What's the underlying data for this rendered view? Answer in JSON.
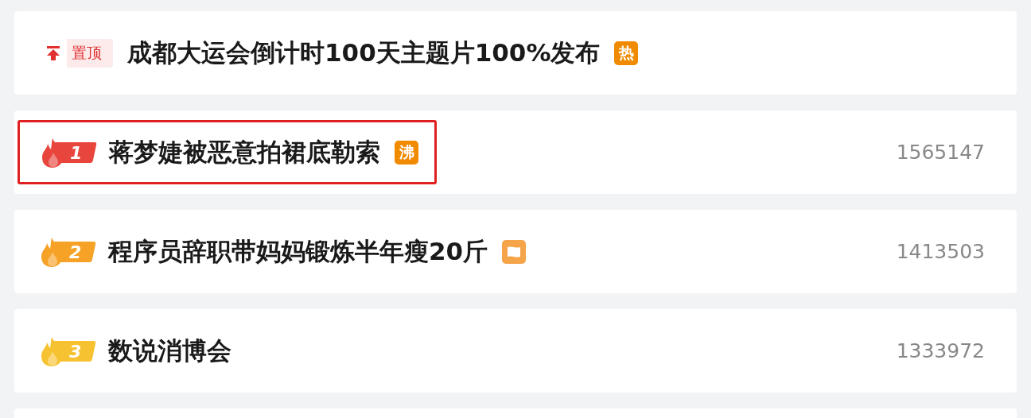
{
  "rows": [
    {
      "kind": "pinned",
      "label": "置顶",
      "title": "成都大运会倒计时100天主题片100%发布",
      "badge": {
        "kind": "text",
        "text": "热"
      },
      "highlighted": false
    },
    {
      "kind": "ranked",
      "rank": "1",
      "color": "#e8453c",
      "title": "蒋梦婕被恶意拍裙底勒索",
      "badge": {
        "kind": "text",
        "text": "沸"
      },
      "count": "1565147",
      "highlighted": true
    },
    {
      "kind": "ranked",
      "rank": "2",
      "color": "#f5a226",
      "title": "程序员辞职带妈妈锻炼半年瘦20斤",
      "badge": {
        "kind": "scroll"
      },
      "count": "1413503",
      "highlighted": false
    },
    {
      "kind": "ranked",
      "rank": "3",
      "color": "#f7c231",
      "title": "数说消博会",
      "count": "1333972",
      "highlighted": false
    }
  ]
}
